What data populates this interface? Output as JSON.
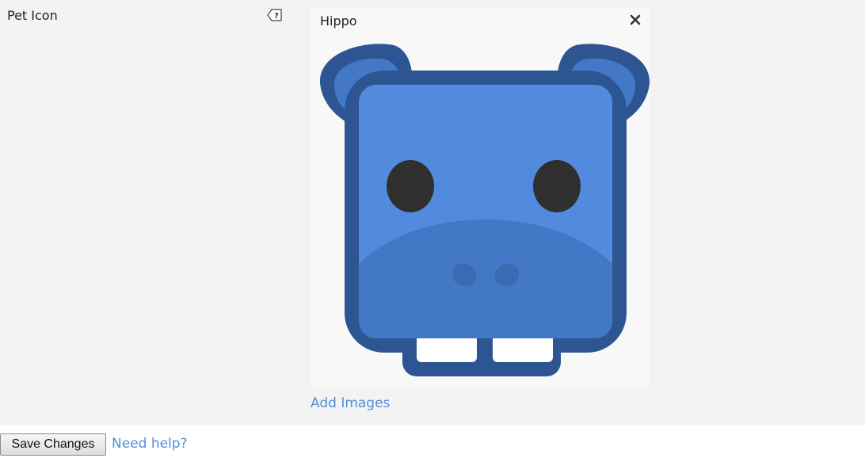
{
  "field": {
    "label": "Pet Icon",
    "help_icon": "help-tooltip-icon"
  },
  "image_card": {
    "title": "Hippo",
    "remove_icon": "close-icon",
    "image_subject": "hippo-face-icon"
  },
  "add_images_label": "Add Images",
  "footer": {
    "save_label": "Save Changes",
    "help_label": "Need help?"
  },
  "colors": {
    "panel_background": "#f3f3f3",
    "link": "#4f8fd8",
    "hippo_outline": "#2c5592",
    "hippo_face": "#528ade",
    "hippo_shade": "#4278c5",
    "eye": "#2f2f2f"
  }
}
